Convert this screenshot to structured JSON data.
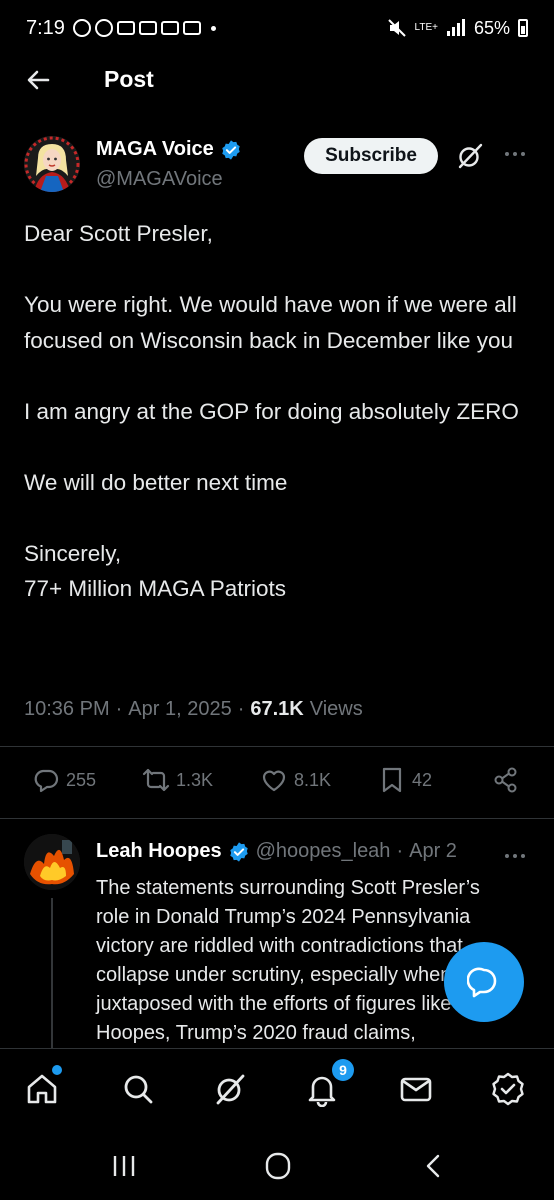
{
  "status_bar": {
    "time": "7:19",
    "network": "LTE+",
    "battery": "65%"
  },
  "header": {
    "title": "Post"
  },
  "post": {
    "author_name": "MAGA Voice",
    "author_handle": "@MAGAVoice",
    "subscribe_label": "Subscribe",
    "body_lines": [
      "Dear Scott Presler,",
      "",
      "You were right. We would have won if we were all focused on Wisconsin back in December like you",
      "",
      "I am angry at the GOP for doing absolutely ZERO",
      "",
      "We will do better next time",
      "",
      "Sincerely,",
      "77+ Million MAGA Patriots"
    ],
    "time": "10:36 PM",
    "date": "Apr 1, 2025",
    "views_count": "67.1K",
    "views_label": "Views",
    "replies": "255",
    "reposts": "1.3K",
    "likes": "8.1K",
    "bookmarks": "42"
  },
  "reply": {
    "name": "Leah Hoopes",
    "handle": "@hoopes_leah",
    "date": "Apr 2",
    "text": "The statements surrounding Scott Presler’s role in Donald Trump’s 2024 Pennsylvania victory are riddled with contradictions that collapse under scrutiny, especially when juxtaposed with the efforts of figures like Leah Hoopes, Trump’s 2020 fraud claims,"
  },
  "nav": {
    "notifications_badge": "9",
    "icons": [
      "home-icon",
      "search-icon",
      "grok-icon",
      "notifications-icon",
      "messages-icon",
      "verified-icon"
    ]
  },
  "colors": {
    "accent": "#1d9bf0",
    "background": "#000000",
    "muted": "#71767b"
  }
}
